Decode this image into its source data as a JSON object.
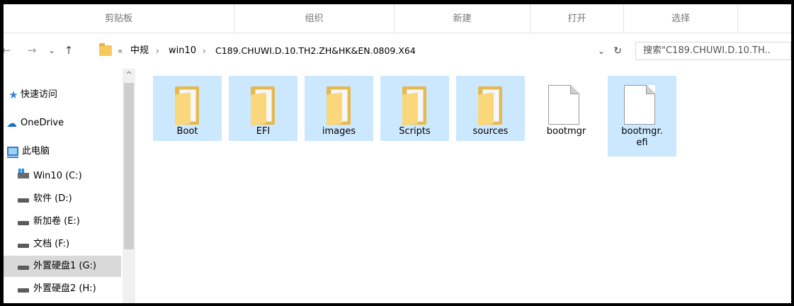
{
  "ribbon": {
    "groups": [
      "剪贴板",
      "组织",
      "新建",
      "打开",
      "选择"
    ]
  },
  "nav": {
    "back": "←",
    "forward": "→",
    "recent": "⌄",
    "up": "↑"
  },
  "address": {
    "overflow": "«",
    "crumbs": [
      "中规",
      "win10",
      "C189.CHUWI.D.10.TH2.ZH&HK&EN.0809.X64"
    ],
    "separator": "›",
    "dropdown": "⌄",
    "refresh": "↻"
  },
  "search": {
    "placeholder": "搜索\"C189.CHUWI.D.10.TH.."
  },
  "sidebar": {
    "items": [
      {
        "label": "快速访问",
        "icon": "star-icon"
      },
      {
        "label": "OneDrive",
        "icon": "cloud-icon"
      },
      {
        "label": "此电脑",
        "icon": "computer-icon"
      },
      {
        "label": "Win10 (C:)",
        "icon": "windows-drive-icon"
      },
      {
        "label": "软件 (D:)",
        "icon": "drive-icon"
      },
      {
        "label": "新加卷 (E:)",
        "icon": "drive-icon"
      },
      {
        "label": "文档 (F:)",
        "icon": "drive-icon"
      },
      {
        "label": "外置硬盘1 (G:)",
        "icon": "drive-icon",
        "selected": true
      },
      {
        "label": "外置硬盘2 (H:)",
        "icon": "drive-icon"
      }
    ]
  },
  "scrollbar": {
    "up_arrow": "^"
  },
  "files": [
    {
      "name": "Boot",
      "type": "folder"
    },
    {
      "name": "EFI",
      "type": "folder"
    },
    {
      "name": "images",
      "type": "folder"
    },
    {
      "name": "Scripts",
      "type": "folder"
    },
    {
      "name": "sources",
      "type": "folder"
    },
    {
      "name": "bootmgr",
      "type": "file"
    },
    {
      "name": "bootmgr.efi",
      "type": "file"
    }
  ],
  "colors": {
    "selection": "#cce8ff",
    "folder": "#f6c95b",
    "nav_selected": "#d9d9d9"
  }
}
